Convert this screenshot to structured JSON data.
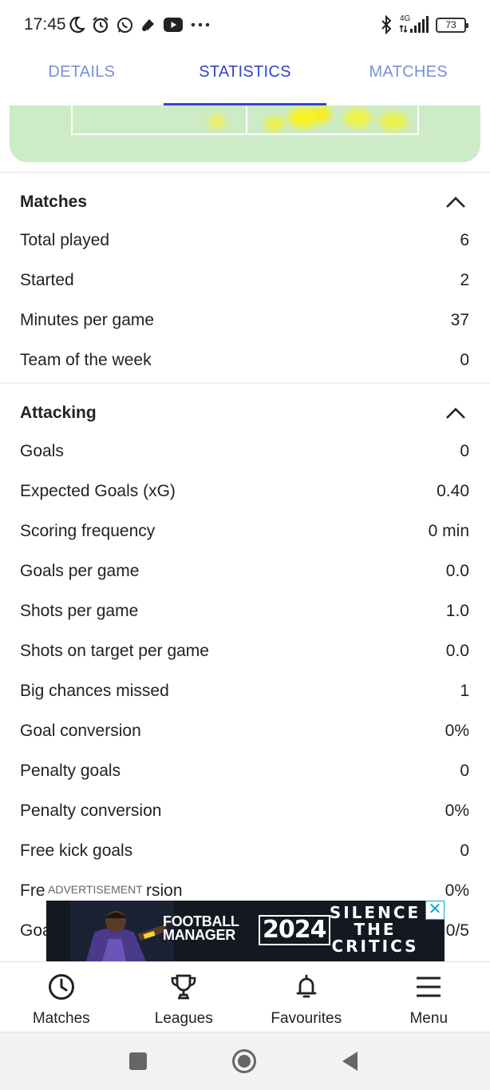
{
  "status_bar": {
    "time": "17:45",
    "left_icons": [
      "moon-icon",
      "alarm-icon",
      "whatsapp-icon",
      "app-icon",
      "youtube-icon",
      "more-dots-icon"
    ],
    "network": "4G",
    "battery": "73"
  },
  "tabs": [
    {
      "label": "DETAILS",
      "active": false
    },
    {
      "label": "STATISTICS",
      "active": true
    },
    {
      "label": "MATCHES",
      "active": false
    }
  ],
  "colors": {
    "accent": "#3346c9",
    "tab_inactive": "#7b8fd9",
    "heatmap_bg": "#cdebc6",
    "heatmap_hot": "#f7f22a"
  },
  "matches": {
    "title": "Matches",
    "rows": [
      {
        "label": "Total played",
        "value": "6"
      },
      {
        "label": "Started",
        "value": "2"
      },
      {
        "label": "Minutes per game",
        "value": "37"
      },
      {
        "label": "Team of the week",
        "value": "0"
      }
    ]
  },
  "attacking": {
    "title": "Attacking",
    "rows": [
      {
        "label": "Goals",
        "value": "0"
      },
      {
        "label": "Expected Goals (xG)",
        "value": "0.40"
      },
      {
        "label": "Scoring frequency",
        "value": "0 min"
      },
      {
        "label": "Goals per game",
        "value": "0.0"
      },
      {
        "label": "Shots per game",
        "value": "1.0"
      },
      {
        "label": "Shots on target per game",
        "value": "0.0"
      },
      {
        "label": "Big chances missed",
        "value": "1"
      },
      {
        "label": "Goal conversion",
        "value": "0%"
      },
      {
        "label": "Penalty goals",
        "value": "0"
      },
      {
        "label": "Penalty conversion",
        "value": "0%"
      },
      {
        "label": "Free kick goals",
        "value": "0"
      },
      {
        "label": "Fre",
        "label_tail": "rsion",
        "value": "0%"
      },
      {
        "label": "Goa",
        "value": "0/5"
      }
    ]
  },
  "ad": {
    "label": "ADVERTISEMENT",
    "brand_line1": "FOOTBALL",
    "brand_line2": "MANAGER",
    "year": "2024",
    "slogan_line1": "SILENCE",
    "slogan_line2": "THE",
    "slogan_line3": "CRITICS",
    "close": "✕"
  },
  "bottom_nav": [
    {
      "label": "Matches",
      "icon": "clock-icon"
    },
    {
      "label": "Leagues",
      "icon": "trophy-icon"
    },
    {
      "label": "Favourites",
      "icon": "bell-icon"
    },
    {
      "label": "Menu",
      "icon": "hamburger-icon"
    }
  ],
  "system_nav": [
    "recents-square-icon",
    "home-circle-icon",
    "back-triangle-icon"
  ]
}
